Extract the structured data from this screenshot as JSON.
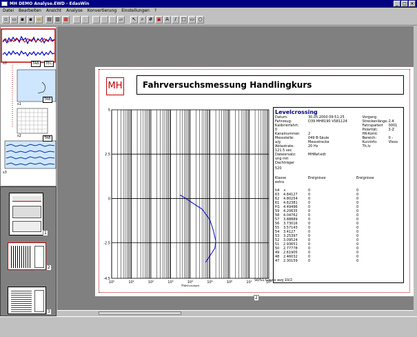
{
  "window": {
    "title": "MH DEMO Analyse.EWD - EdasWin"
  },
  "menu": [
    "Datei",
    "Bearbeiten",
    "Ansicht",
    "Analyse",
    "Konvertierung",
    "Einstellungen",
    "?"
  ],
  "sidebar": {
    "items": [
      {
        "name": "s0",
        "tabs": [
          "TAB",
          "TEC"
        ]
      },
      {
        "name": "s1",
        "tabs": [
          "TAB"
        ]
      },
      {
        "name": "s2",
        "tabs": [
          "TAB"
        ]
      },
      {
        "name": "s3",
        "tabs": []
      }
    ],
    "pages": [
      "1",
      "2",
      "3"
    ]
  },
  "report": {
    "logo": "MH",
    "title": "Fahrversuchsmessung Handlingkurs",
    "page_number": "2",
    "legend": "S0/S1:Gauss   avg   10/2",
    "panel": {
      "heading": "Levelcrossing",
      "info_left": [
        [
          "Datum:",
          "30.05.2000   09:51:25"
        ],
        [
          "Fahrzeug:",
          "D39 MH8190 VS81124"
        ],
        [
          "Kalibrierfahrt:",
          ""
        ],
        [
          "0",
          ""
        ],
        [
          "Kanalnummer:",
          "2"
        ],
        [
          "Messstelle:",
          "049 B-Säule"
        ],
        [
          "a/g",
          "Messstrecke"
        ],
        [
          "Abtastrate:",
          "20 Hz"
        ],
        [
          "121.5 sec",
          ""
        ],
        [
          "Dateiersatz:",
          "MHRef.edt"
        ],
        [
          "ung mit Dachträger",
          ""
        ]
      ],
      "info_right": [
        [
          "Vorgang",
          ""
        ],
        [
          "Streckenlänge:",
          "2.4"
        ],
        [
          "Fahrspaltert",
          "0001"
        ],
        [
          "Polarität:",
          "Σ-Z"
        ],
        [
          "HK-Komt.",
          ""
        ],
        [
          "Bereich:",
          "0 -"
        ],
        [
          "Kurzinfo:",
          "Vleos"
        ],
        [
          "Th.Iv",
          ""
        ]
      ],
      "extra": "520",
      "col_headers": [
        "Klasse",
        "Ereignisse",
        "Ereignisse"
      ],
      "col_sub": "extra",
      "rows": [
        [
          "h4",
          "∧",
          "0",
          "0"
        ],
        [
          "63",
          "4.84127",
          "0",
          "0"
        ],
        [
          "62",
          "4.80254",
          "0",
          "0"
        ],
        [
          "61",
          "4.62381",
          "0",
          "0"
        ],
        [
          "H1",
          "4.49496",
          "0",
          "0"
        ],
        [
          "59",
          "4.20635",
          "0",
          "0"
        ],
        [
          "58",
          "4.04762",
          "0",
          "0"
        ],
        [
          "57",
          "3.88889",
          "0",
          "0"
        ],
        [
          "56",
          "3.73016",
          "0",
          "0"
        ],
        [
          "55",
          "3.57143",
          "0",
          "0"
        ],
        [
          "54",
          "3.4127",
          "0",
          "0"
        ],
        [
          "53",
          "3.25397",
          "0",
          "0"
        ],
        [
          "52",
          "3.09524",
          "0",
          "0"
        ],
        [
          "51",
          "2.93651",
          "0",
          "0"
        ],
        [
          "50",
          "2.77778",
          "0",
          "0"
        ],
        [
          "49",
          "2.61905",
          "0",
          "0"
        ],
        [
          "48",
          "2.46032",
          "0",
          "0"
        ],
        [
          "47",
          "2.30159",
          "0",
          "0"
        ]
      ]
    }
  },
  "chart_data": {
    "type": "line",
    "xscale": "log",
    "xlim": [
      1,
      100000000
    ],
    "ylim": [
      -4.5,
      5
    ],
    "x_ticks": [
      "10⁰",
      "10¹",
      "10²",
      "10³",
      "10⁴",
      "10⁵",
      "10⁶",
      "10⁷",
      "10⁸"
    ],
    "y_ticks": [
      "5",
      "2.5",
      "0",
      "-2.5",
      "-4.5"
    ],
    "xlabel": "Zählungen",
    "ylabel": "",
    "series": [
      {
        "x": [
          3000,
          6000,
          15000,
          40000,
          100000,
          150000,
          200000,
          180000,
          120000,
          80000,
          60000
        ],
        "y": [
          0.2,
          0,
          -0.3,
          -0.6,
          -1.2,
          -1.8,
          -2.4,
          -2.8,
          -3.1,
          -3.4,
          -3.6
        ]
      }
    ]
  },
  "colors": {
    "accent": "#c00000",
    "titlebar": "#000080",
    "chart_line": "#0000cc"
  }
}
